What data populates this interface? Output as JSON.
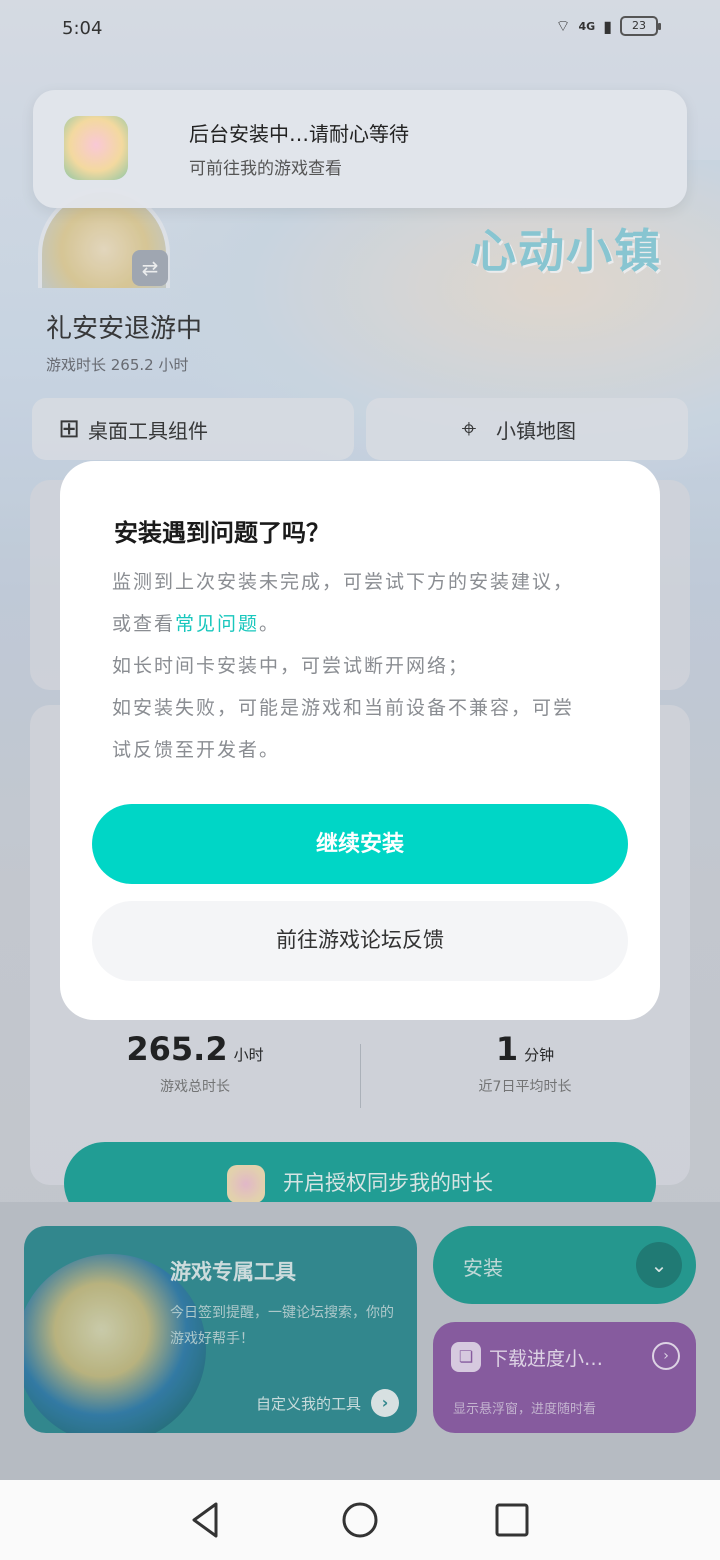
{
  "status_bar": {
    "time": "5:04",
    "network": "4G",
    "battery": "23"
  },
  "notification": {
    "title": "后台安装中…请耐心等待",
    "subtitle": "可前往我的游戏查看"
  },
  "background": {
    "game_logo": "心动小镇",
    "user_name": "礼安安退游中",
    "play_time": "游戏时长 265.2 小时",
    "tools": [
      {
        "label": "桌面工具组件",
        "icon": "widget-grid-icon"
      },
      {
        "label": "小镇地图",
        "icon": "map-pin-icon"
      }
    ],
    "stats": [
      {
        "value": "265.2",
        "unit": "小时",
        "label": "游戏总时长"
      },
      {
        "value": "1",
        "unit": "分钟",
        "label": "近7日平均时长"
      }
    ],
    "auth_button": "开启授权同步我的时长",
    "tool_card": {
      "title": "游戏专属工具",
      "desc": "今日签到提醒，一键论坛搜索，你的游戏好帮手！",
      "custom": "自定义我的工具"
    },
    "install_card": {
      "label": "安装"
    },
    "download_card": {
      "title": "下载进度小…",
      "desc": "显示悬浮窗，进度随时看"
    }
  },
  "modal": {
    "title": "安装遇到问题了吗？",
    "body_part1": "监测到上次安装未完成，可尝试下方的安装建议，或查看",
    "body_link": "常见问题",
    "body_part2": "。",
    "body_line2": "如长时间卡安装中，可尝试断开网络；",
    "body_line3": "如安装失败，可能是游戏和当前设备不兼容，可尝试反馈至开发者。",
    "primary_button": "继续安装",
    "secondary_button": "前往游戏论坛反馈"
  },
  "colors": {
    "accent": "#00d6c6",
    "link": "#19c7bd",
    "tool_card": "#2d8d92",
    "download_card": "#8c5aa6"
  }
}
